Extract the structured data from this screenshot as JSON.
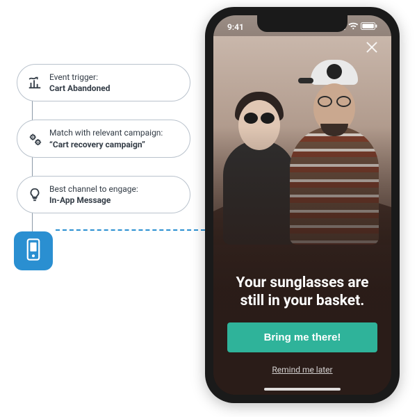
{
  "flow": {
    "steps": [
      {
        "label": "Event trigger:",
        "value": "Cart Abandoned",
        "icon": "analytics-icon"
      },
      {
        "label": "Match with relevant campaign:",
        "value": "“Cart recovery campaign”",
        "icon": "gears-icon"
      },
      {
        "label": "Best channel to engage:",
        "value": "In-App Message",
        "icon": "bulb-icon"
      }
    ],
    "result_icon": "phone-icon"
  },
  "phone": {
    "status_time": "9:41",
    "message_title": "Your sunglasses are still in your basket.",
    "cta_label": "Bring me there!",
    "secondary_label": "Remind me later"
  },
  "colors": {
    "accent_blue": "#2a8fd1",
    "cta_green": "#2fb39a"
  }
}
